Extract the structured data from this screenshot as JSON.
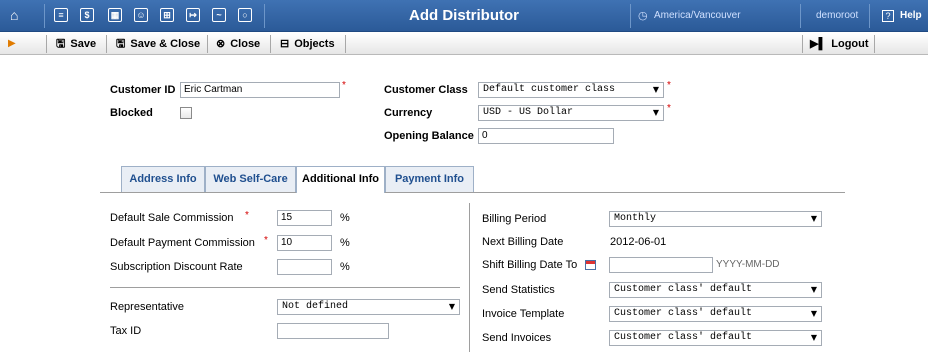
{
  "topbar": {
    "title": "Add Distributor",
    "timezone": "America/Vancouver",
    "user": "demoroot",
    "help": "Help",
    "icons": [
      "home-icon",
      "list-icon",
      "dollar-icon",
      "grid-icon",
      "person-icon",
      "tree-icon",
      "export-icon",
      "chart-icon",
      "search-icon"
    ]
  },
  "actions": {
    "save": "Save",
    "save_close": "Save & Close",
    "close": "Close",
    "objects": "Objects",
    "logout": "Logout"
  },
  "header_form": {
    "customer_id_label": "Customer ID",
    "customer_id_value": "Eric Cartman",
    "blocked_label": "Blocked",
    "customer_class_label": "Customer Class",
    "customer_class_value": "Default customer class",
    "currency_label": "Currency",
    "currency_value": "USD - US Dollar",
    "opening_balance_label": "Opening Balance",
    "opening_balance_value": "0",
    "required_mark": "*"
  },
  "tabs": [
    {
      "label": "Address Info"
    },
    {
      "label": "Web Self-Care"
    },
    {
      "label": "Additional Info"
    },
    {
      "label": "Payment Info"
    }
  ],
  "left_panel": {
    "sale_commission_label": "Default Sale Commission",
    "sale_commission_value": "15",
    "payment_commission_label": "Default Payment Commission",
    "payment_commission_value": "10",
    "discount_label": "Subscription Discount Rate",
    "discount_value": "",
    "percent": "%",
    "representative_label": "Representative",
    "representative_value": "Not defined",
    "tax_id_label": "Tax ID",
    "tax_id_value": ""
  },
  "right_panel": {
    "billing_period_label": "Billing Period",
    "billing_period_value": "Monthly",
    "next_billing_label": "Next Billing Date",
    "next_billing_value": "2012-06-01",
    "shift_label": "Shift Billing Date To",
    "shift_value": "",
    "date_hint": "YYYY-MM-DD",
    "send_statistics_label": "Send Statistics",
    "send_statistics_value": "Customer class' default",
    "invoice_template_label": "Invoice Template",
    "invoice_template_value": "Customer class' default",
    "send_invoices_label": "Send Invoices",
    "send_invoices_value": "Customer class' default"
  }
}
